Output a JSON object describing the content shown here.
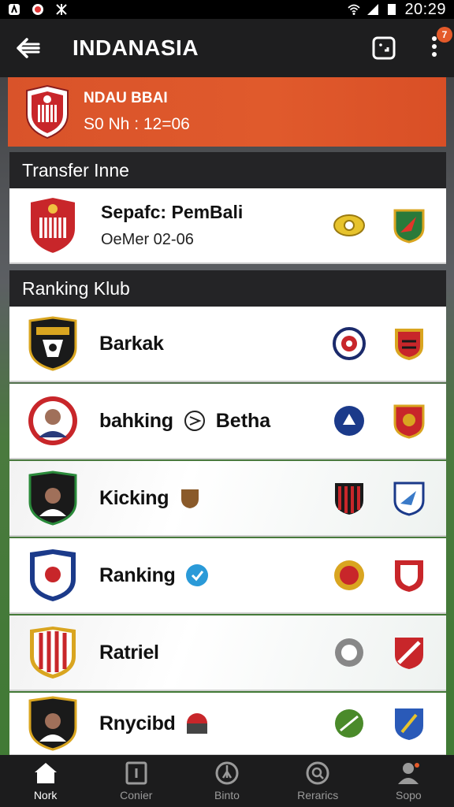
{
  "status_bar": {
    "time": "20:29"
  },
  "app_bar": {
    "title": "INDANASIA",
    "notification_count": "7"
  },
  "match_banner": {
    "title": "NDAU BBAI",
    "subtitle": "S0 Nh : 12=06"
  },
  "transfer_section": {
    "header": "Transfer Inne",
    "item": {
      "title": "Sepafc: PemBali",
      "subtitle": "OeMer 02-06"
    }
  },
  "ranking_section": {
    "header": "Ranking Klub",
    "clubs": [
      {
        "name": "Barkak"
      },
      {
        "name": "bahking",
        "name2": "Betha"
      },
      {
        "name": "Kicking"
      },
      {
        "name": "Ranking"
      },
      {
        "name": "Ratriel"
      },
      {
        "name": "Rnycibd"
      }
    ]
  },
  "bottom_nav": [
    {
      "label": "Nork",
      "icon": "home-icon",
      "active": true
    },
    {
      "label": "Conier",
      "icon": "square-icon",
      "active": false
    },
    {
      "label": "Binto",
      "icon": "chart-circle-icon",
      "active": false
    },
    {
      "label": "Rerarics",
      "icon": "search-circle-icon",
      "active": false
    },
    {
      "label": "Sopo",
      "icon": "profile-icon",
      "active": false
    }
  ],
  "colors": {
    "accent": "#e05a2c",
    "appbar": "#1e1e1f",
    "card": "#ffffff"
  }
}
